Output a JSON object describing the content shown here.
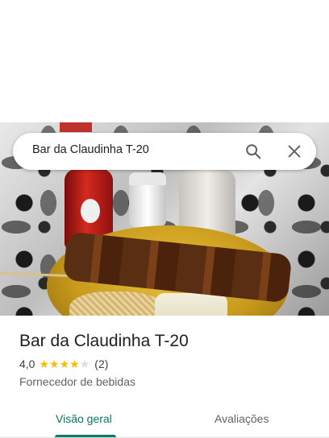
{
  "search": {
    "query": "Bar da Claudinha T-20",
    "search_icon": "search-icon",
    "close_icon": "close-icon"
  },
  "place": {
    "title": "Bar da Claudinha T-20",
    "rating": "4,0",
    "rating_value": 4.0,
    "stars_max": 5,
    "reviews": "(2)",
    "category": "Fornecedor de bebidas"
  },
  "tabs": [
    {
      "label": "Visão geral",
      "active": true
    },
    {
      "label": "Avaliações",
      "active": false
    }
  ],
  "colors": {
    "accent": "#00796b",
    "star": "#fbbc04",
    "star_empty": "#dadce0"
  }
}
